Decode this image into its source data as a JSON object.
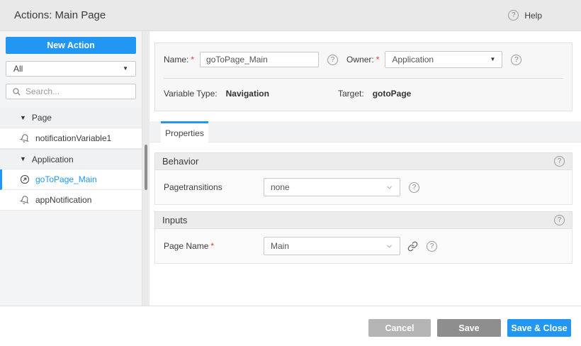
{
  "header": {
    "title": "Actions: Main Page",
    "help_label": "Help"
  },
  "sidebar": {
    "new_action_label": "New Action",
    "filter_value": "All",
    "search_placeholder": "Search...",
    "tree": [
      {
        "type": "group",
        "label": "Page"
      },
      {
        "type": "item",
        "label": "notificationVariable1",
        "icon": "bell-icon",
        "selected": false
      },
      {
        "type": "group",
        "label": "Application"
      },
      {
        "type": "item",
        "label": "goToPage_Main",
        "icon": "goto-page-icon",
        "selected": true
      },
      {
        "type": "item",
        "label": "appNotification",
        "icon": "bell-icon",
        "selected": false
      }
    ]
  },
  "form": {
    "name_label": "Name:",
    "required_marker": "*",
    "name_value": "goToPage_Main",
    "owner_label": "Owner:",
    "owner_value": "Application",
    "variable_type_label": "Variable Type:",
    "variable_type_value": "Navigation",
    "target_label": "Target:",
    "target_value": "gotoPage"
  },
  "tabs": [
    {
      "label": "Properties",
      "active": true
    }
  ],
  "sections": {
    "behavior": {
      "title": "Behavior",
      "field": {
        "label": "Pagetransitions",
        "value": "none"
      }
    },
    "inputs": {
      "title": "Inputs",
      "field": {
        "label": "Page Name",
        "required": "*",
        "value": "Main"
      }
    }
  },
  "footer": {
    "cancel_label": "Cancel",
    "save_label": "Save",
    "save_close_label": "Save & Close"
  },
  "colors": {
    "accent": "#2196f3",
    "titlebar_bg": "#e9e9e9",
    "sidebar_bg": "#f3f4f5",
    "section_header_bg": "#ececec",
    "button_gray_light": "#b4b4b4",
    "button_gray_dark": "#8e8e8e",
    "required_red": "#e53935",
    "selected_text": "#2196f3"
  }
}
